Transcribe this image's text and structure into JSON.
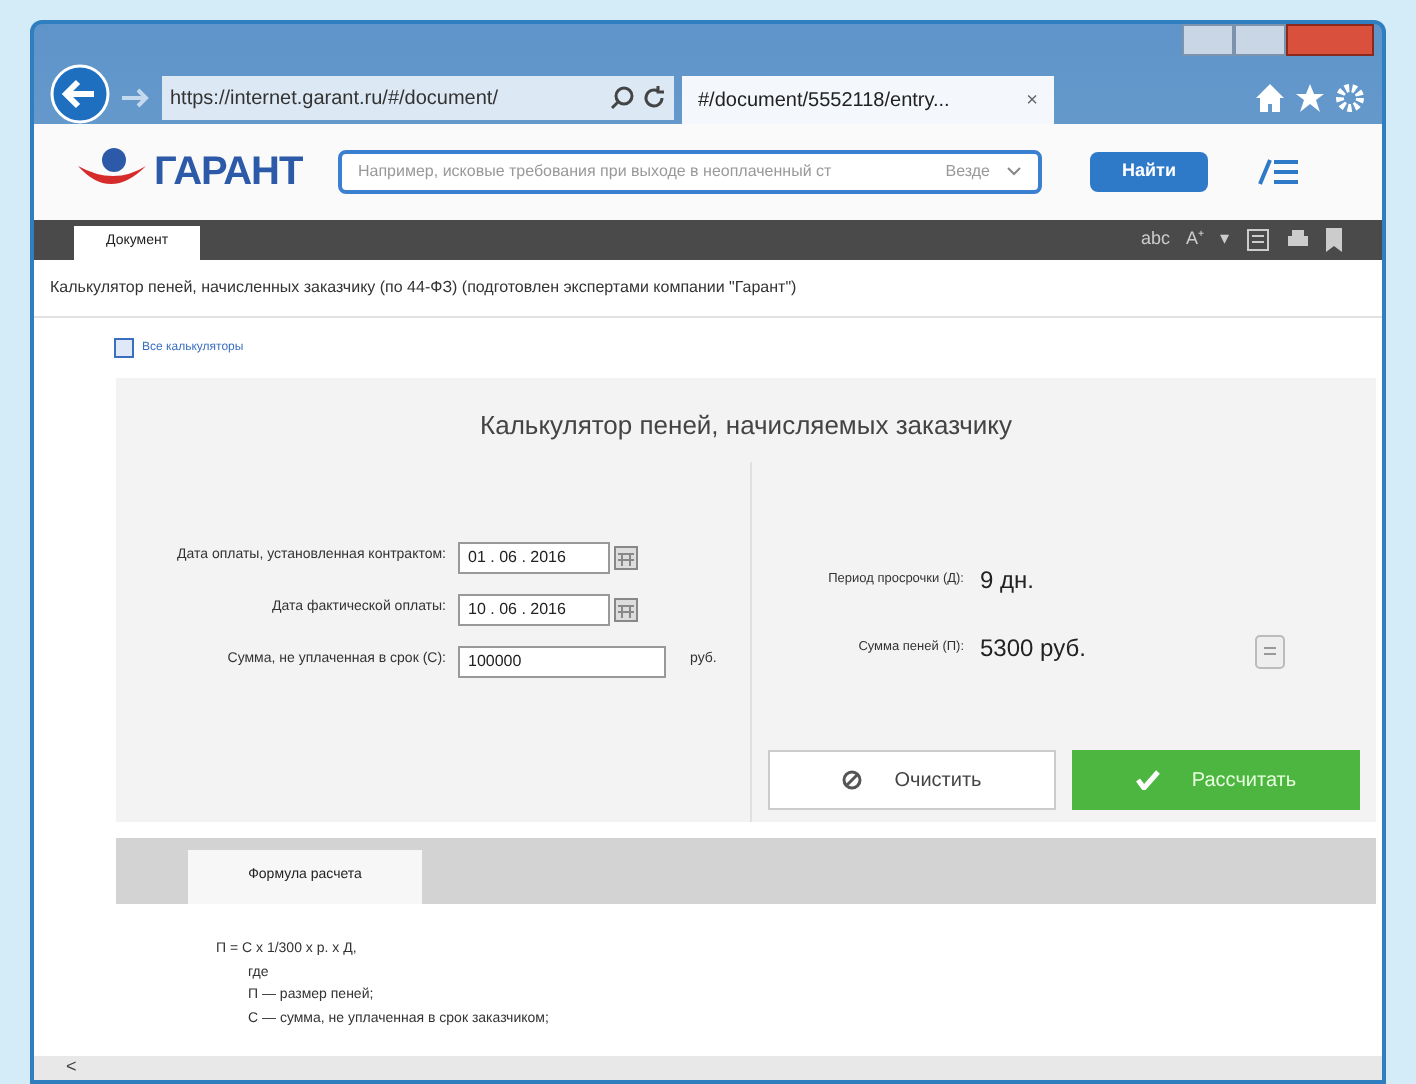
{
  "browser": {
    "address": "https://internet.garant.ru/#/document/",
    "tab": {
      "title": "#/document/5552118/entry...",
      "close": "×"
    }
  },
  "site": {
    "logo": "ГАРАНТ",
    "search": {
      "placeholder": "Например, исковые требования при выходе в неоплаченный ст",
      "scope": "Везде"
    },
    "search_button": "Найти"
  },
  "doc_tabs": [
    {
      "label": "Документ",
      "selected": true
    }
  ],
  "toolbar": [
    "abc",
    "A⁺",
    "▾"
  ],
  "document_title": "Калькулятор пеней, начисленных заказчику (по 44-ФЗ) (подготовлен экспертами компании \"Гарант\")",
  "link": "Все калькуляторы",
  "calculator": {
    "title": "Калькулятор пеней, начисляемых заказчику",
    "fields": [
      {
        "kind": "date",
        "label": "Дата оплаты, установленная контрактом:",
        "value": "01 . 06 . 2016"
      },
      {
        "kind": "date",
        "label": "Дата фактической оплаты:",
        "value": "10 . 06 . 2016"
      },
      {
        "kind": "money",
        "label": "Сумма, не уплаченная в срок (С):",
        "value": "100000",
        "unit": "руб."
      }
    ],
    "results": [
      {
        "label": "Период просрочки (Д):",
        "value": "9 дн."
      },
      {
        "label": "Сумма пеней (П):",
        "value": "5300 руб."
      }
    ],
    "buttons": [
      {
        "kind": "clear",
        "label": "Очистить"
      },
      {
        "kind": "calculate",
        "label": "Рассчитать"
      }
    ]
  },
  "formula_tabs": [
    {
      "label": "Формула расчета",
      "selected": true
    }
  ],
  "formula": [
    "П = С х 1/300 х р. х Д,",
    "где",
    "П — размер пеней;",
    "С — сумма, не уплаченная в срок заказчиком;"
  ],
  "scroll_left": "<"
}
